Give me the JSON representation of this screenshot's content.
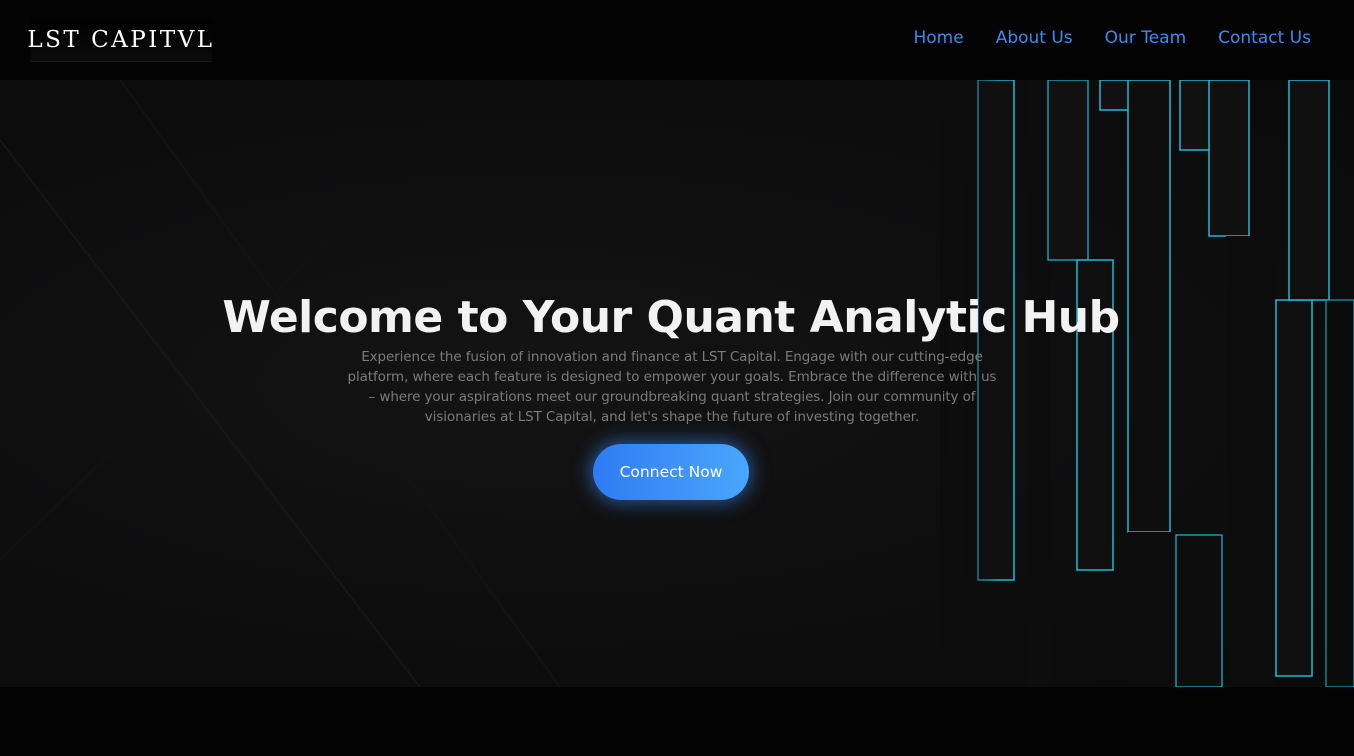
{
  "brand": {
    "logo_text": "LST CAPITVL"
  },
  "nav": {
    "items": [
      {
        "label": "Home"
      },
      {
        "label": "About Us"
      },
      {
        "label": "Our Team"
      },
      {
        "label": "Contact Us"
      }
    ]
  },
  "hero": {
    "title": "Welcome to Your Quant Analytic Hub",
    "description": "Experience the fusion of innovation and finance at LST Capital. Engage with our cutting-edge platform, where each feature is designed to empower your goals. Embrace the difference with us – where your aspirations meet our groundbreaking quant strategies. Join our community of visionaries at LST Capital, and let's shape the future of investing together.",
    "cta_label": "Connect Now"
  },
  "colors": {
    "nav_link": "#3d8bf2",
    "accent_cyan": "#1fb8d6",
    "button_start": "#2f7cf3",
    "button_end": "#4aa6fb"
  }
}
